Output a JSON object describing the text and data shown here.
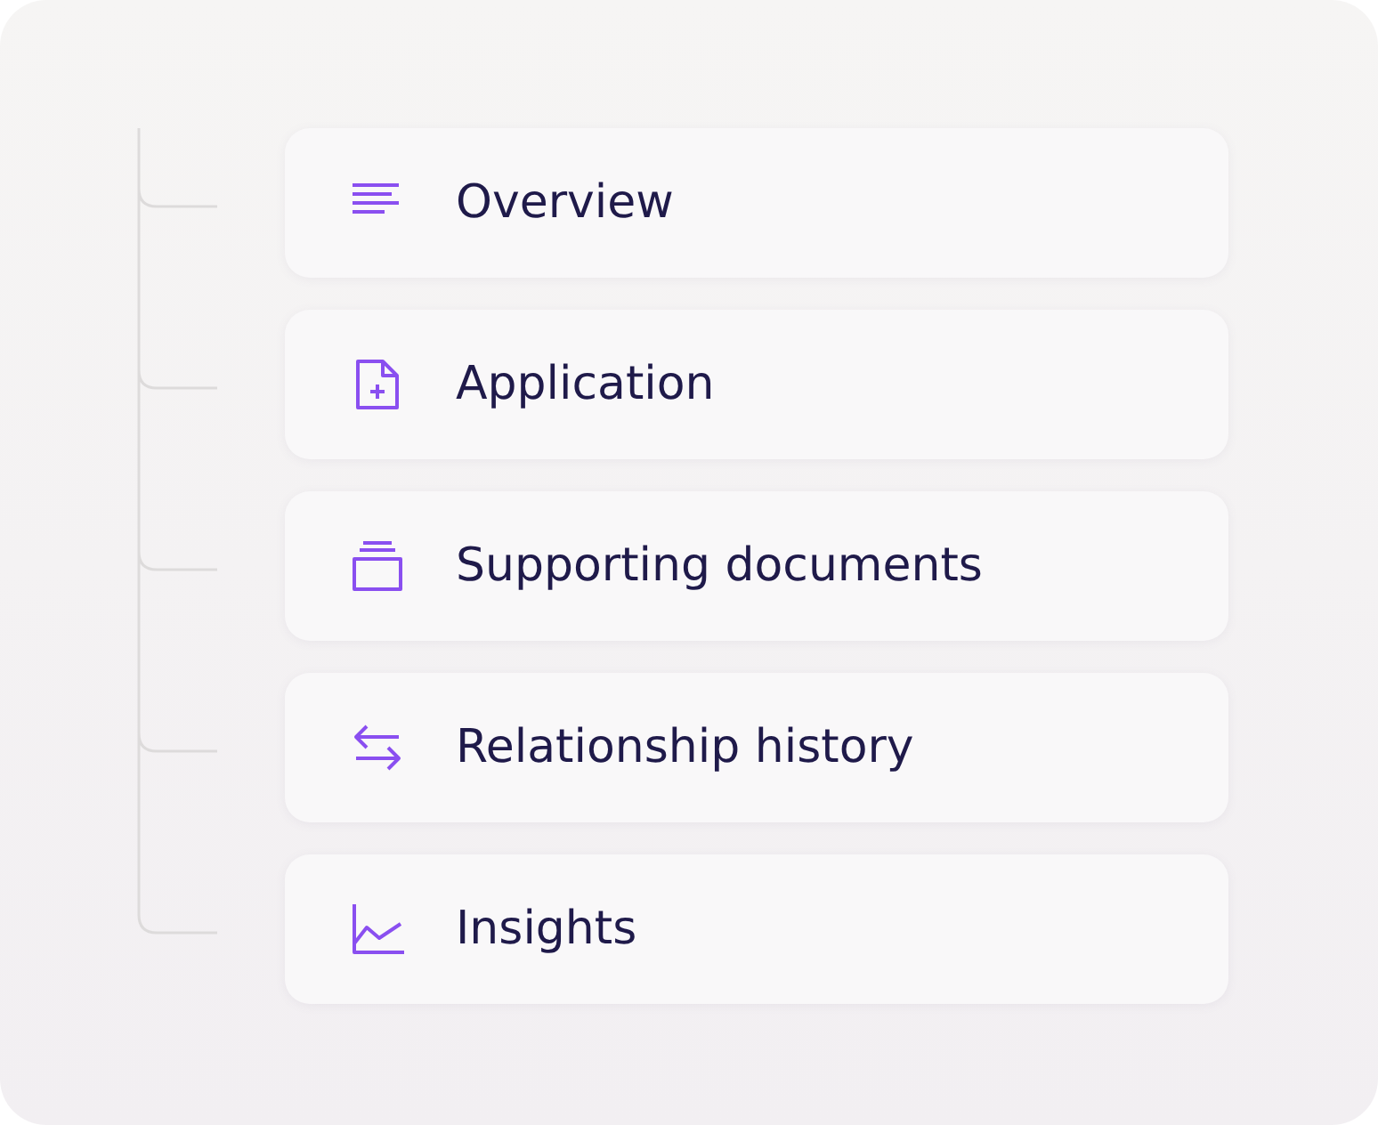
{
  "items": [
    {
      "kind": "overview",
      "label": "Overview"
    },
    {
      "kind": "application",
      "label": "Application"
    },
    {
      "kind": "documents",
      "label": "Supporting documents"
    },
    {
      "kind": "history",
      "label": "Relationship history"
    },
    {
      "kind": "insights",
      "label": "Insights"
    }
  ]
}
